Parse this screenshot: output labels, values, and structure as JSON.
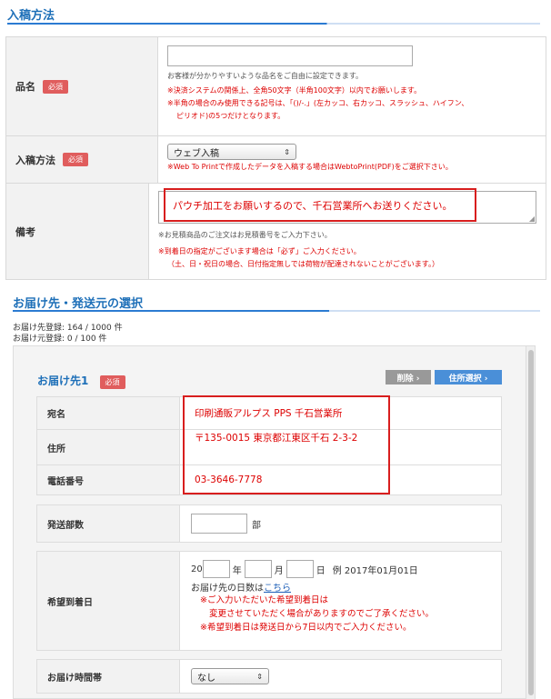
{
  "sections": {
    "submission_title": "入稿方法",
    "delivery_title": "お届け先・発送元の選択"
  },
  "badge_required": "必須",
  "product_name": {
    "label": "品名",
    "value": "",
    "note": "お客様が分かりやすいような品名をご自由に設定できます。",
    "warning_1": "※決済システムの関係上、全角50文字（半角100文字）以内でお願いします。",
    "warning_2": "※半角の場合のみ使用できる記号は、「()/-.」(左カッコ、右カッコ、スラッシュ、ハイフン、",
    "warning_3": "ピリオド)の5つだけとなります。"
  },
  "method": {
    "label": "入稿方法",
    "selected": "ウェブ入稿",
    "warning": "※Web To Printで作成したデータを入稿する場合はWebtoPrint(PDF)をご選択下さい。"
  },
  "remarks": {
    "label": "備考",
    "value": "パウチ加工をお願いするので、千石営業所へお送りください。",
    "note": "※お見積商品のご注文はお見積番号をご入力下さい。",
    "warning_1": "※到着日の指定がございます場合は「必ず」ご入力ください。",
    "warning_2": "（土、日・祝日の場合、日付指定無しでは荷物が配達されないことがございます。）"
  },
  "stats": {
    "dest_count": "お届け先登録: 164 / 1000 件",
    "origin_count": "お届け元登録: 0 / 100 件"
  },
  "destination": {
    "title": "お届け先1",
    "delete_label": "削除 ›",
    "address_select_label": "住所選択 ›",
    "recipient_label": "宛名",
    "recipient_value": "印刷通販アルプス PPS 千石営業所",
    "address_label": "住所",
    "address_value": "〒135-0015 東京都江東区千石 2-3-2",
    "phone_label": "電話番号",
    "phone_value": "03-3646-7778",
    "copies_label": "発送部数",
    "copies_value": "",
    "copies_unit": "部",
    "arrival_label": "希望到着日",
    "year_prefix": "20",
    "year_suffix": "年",
    "month_suffix": "月",
    "day_suffix": "日",
    "example": "例 2017年01月01日",
    "days_text": "お届け先の日数は",
    "days_link": "こちら",
    "warn_1": "※ご入力いただいた希望到着日は",
    "warn_2": "変更させていただく場合がありますのでご了承ください。",
    "warn_3": "※希望到着日は発送日から7日以内でご入力ください。",
    "time_label": "お届け時間帯",
    "time_selected": "なし"
  },
  "icons": {
    "select_arrow": "⇕",
    "resize_grip": "◢"
  },
  "colors": {
    "accent_blue": "#1d6fb8",
    "required_badge": "#e05d5d",
    "warning_red": "#d00000",
    "highlight_red": "#d81e1e"
  }
}
